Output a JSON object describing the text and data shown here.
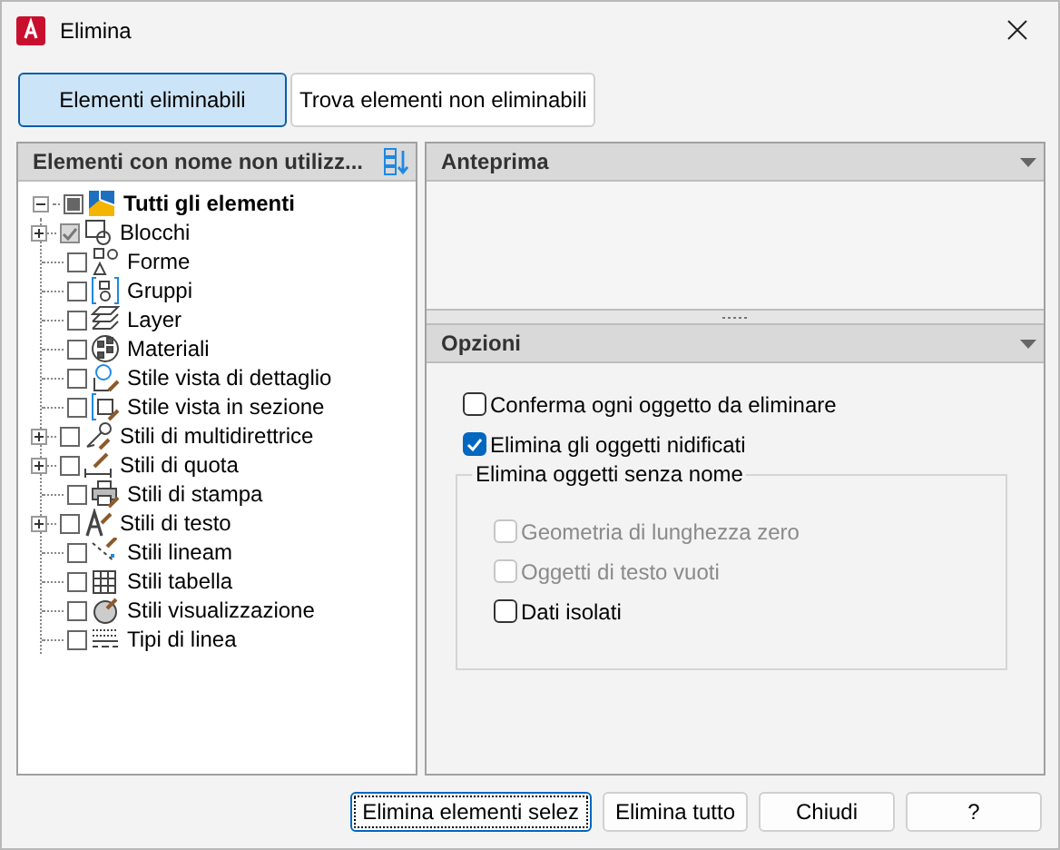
{
  "window": {
    "title": "Elimina"
  },
  "tabs": [
    {
      "label": "Elementi eliminabili",
      "selected": true
    },
    {
      "label": "Trova elementi non eliminabili",
      "selected": false
    }
  ],
  "tree": {
    "header": "Elementi con nome non utilizz...",
    "root": {
      "label": "Tutti gli elementi",
      "expanded": true,
      "partial": true,
      "children": [
        {
          "label": "Blocchi",
          "expandable": true,
          "checked": true
        },
        {
          "label": "Forme",
          "expandable": false,
          "checked": false
        },
        {
          "label": "Gruppi",
          "expandable": false,
          "checked": false
        },
        {
          "label": "Layer",
          "expandable": false,
          "checked": false
        },
        {
          "label": "Materiali",
          "expandable": false,
          "checked": false
        },
        {
          "label": "Stile vista di dettaglio",
          "expandable": false,
          "checked": false
        },
        {
          "label": "Stile vista in sezione",
          "expandable": false,
          "checked": false
        },
        {
          "label": "Stili di multidirettrice",
          "expandable": true,
          "checked": false
        },
        {
          "label": "Stili di quota",
          "expandable": true,
          "checked": false
        },
        {
          "label": "Stili di stampa",
          "expandable": false,
          "checked": false
        },
        {
          "label": "Stili di testo",
          "expandable": true,
          "checked": false
        },
        {
          "label": "Stili lineam",
          "expandable": false,
          "checked": false
        },
        {
          "label": "Stili tabella",
          "expandable": false,
          "checked": false
        },
        {
          "label": "Stili visualizzazione",
          "expandable": false,
          "checked": false
        },
        {
          "label": "Tipi di linea",
          "expandable": false,
          "checked": false
        }
      ]
    }
  },
  "preview": {
    "title": "Anteprima"
  },
  "options": {
    "title": "Opzioni",
    "items": [
      {
        "label": "Conferma ogni oggetto da eliminare",
        "checked": false,
        "disabled": false
      },
      {
        "label": "Elimina gli oggetti nidificati",
        "checked": true,
        "disabled": false
      }
    ],
    "group": {
      "title": "Elimina oggetti senza nome",
      "items": [
        {
          "label": "Geometria di lunghezza zero",
          "checked": false,
          "disabled": true
        },
        {
          "label": "Oggetti di testo vuoti",
          "checked": false,
          "disabled": true
        },
        {
          "label": "Dati isolati",
          "checked": false,
          "disabled": false
        }
      ]
    }
  },
  "buttons": [
    {
      "label": "Elimina elementi selez",
      "focused": true
    },
    {
      "label": "Elimina tutto",
      "focused": false
    },
    {
      "label": "Chiudi",
      "focused": false
    },
    {
      "label": "?",
      "focused": false
    }
  ]
}
